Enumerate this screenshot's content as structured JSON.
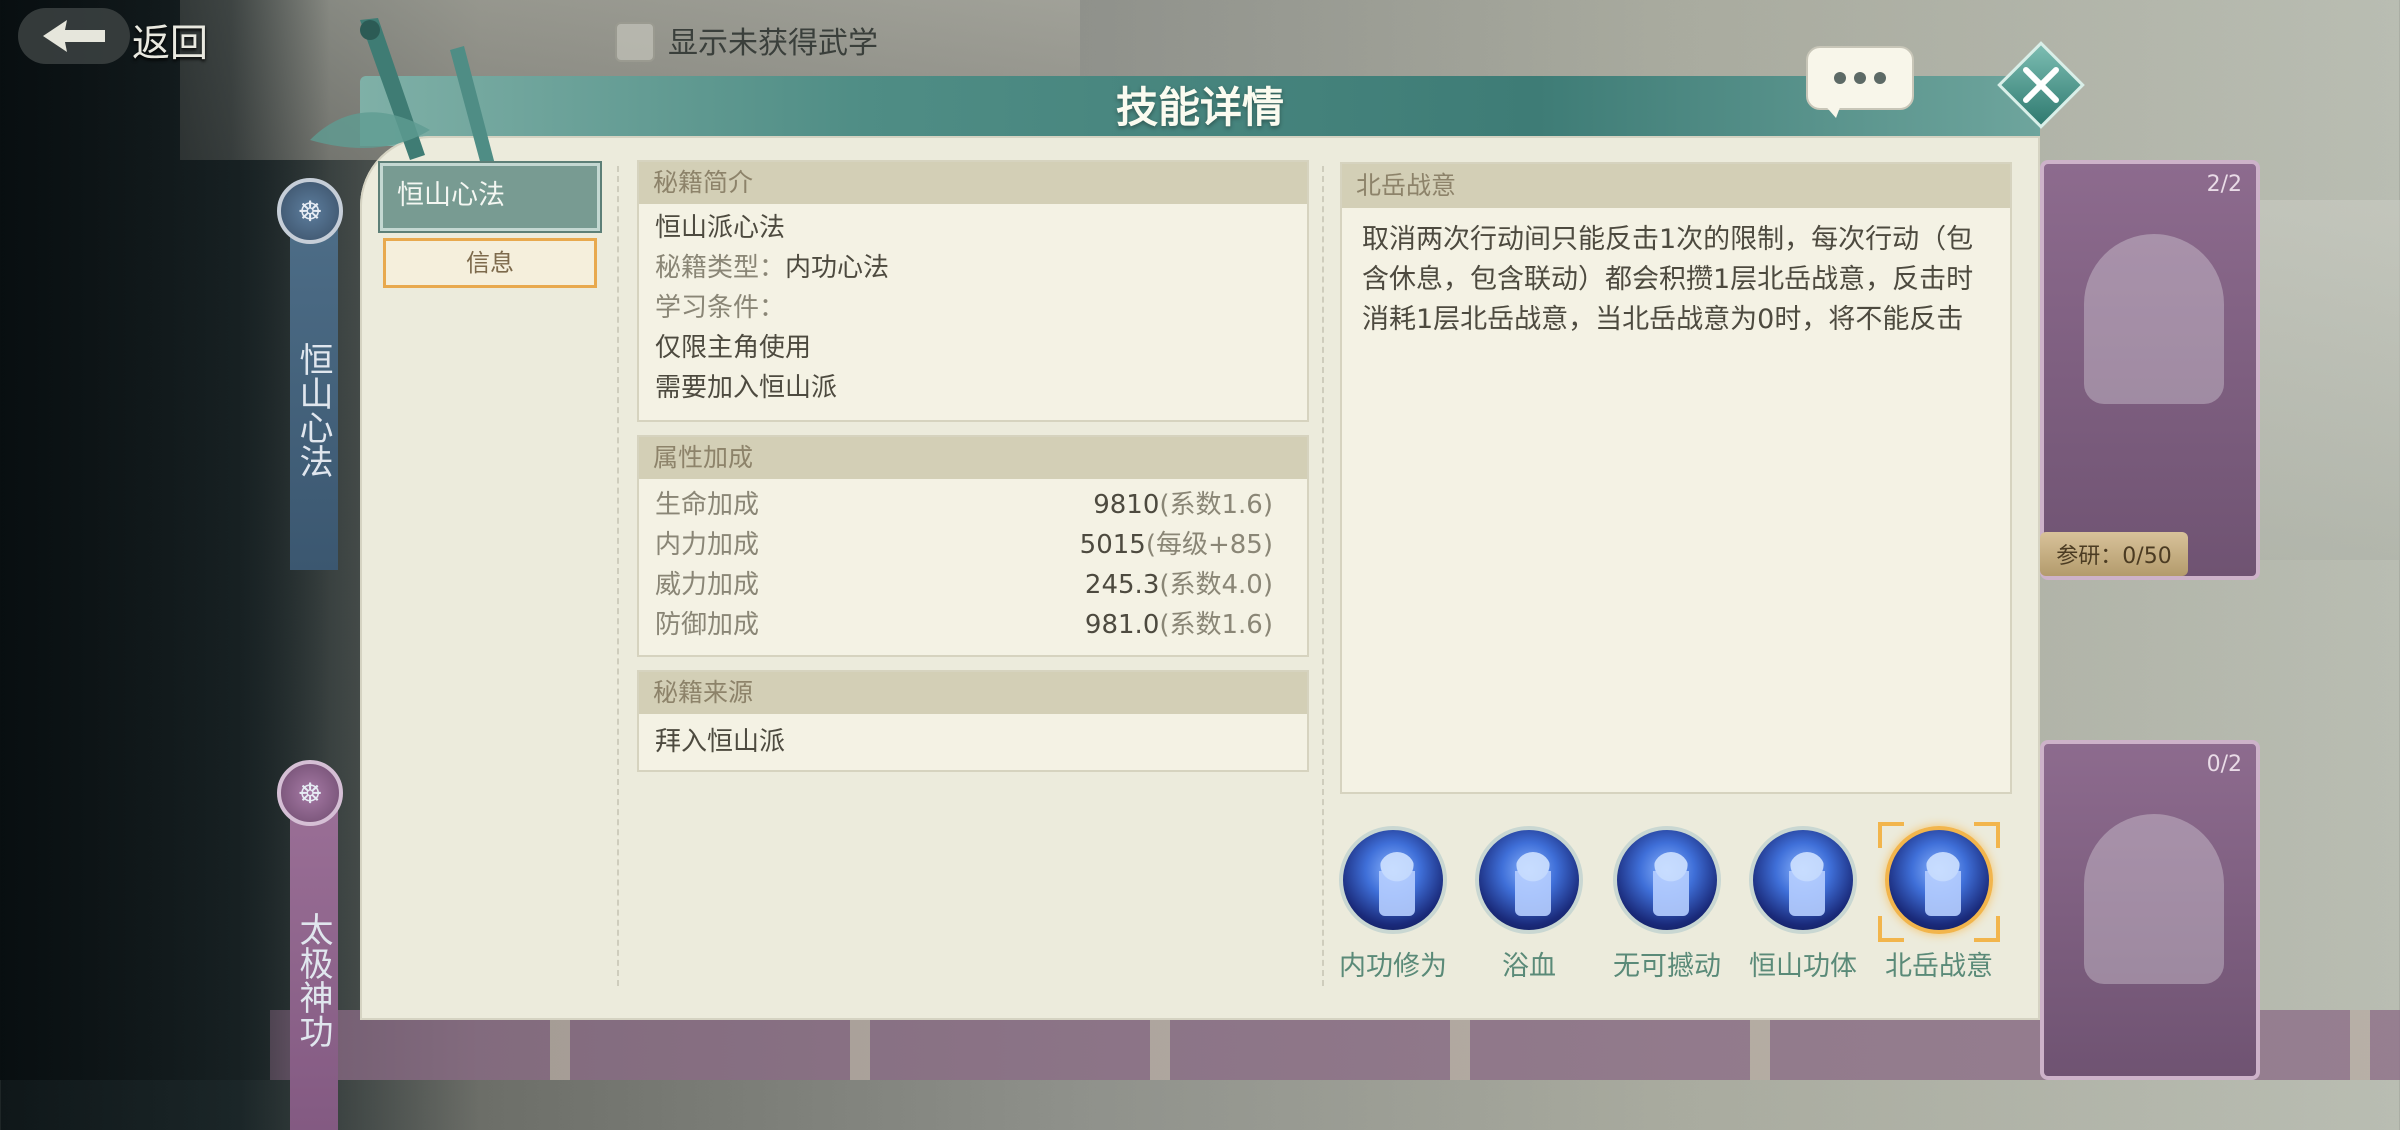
{
  "header": {
    "back_label": "返回",
    "show_unobtained_label": "显示未获得武学"
  },
  "side_scrolls": [
    {
      "label": "恒山心法"
    },
    {
      "label": "太极神功"
    }
  ],
  "cards": [
    {
      "count": "2/2",
      "research": "参研：0/50"
    },
    {
      "count": "0/2"
    }
  ],
  "dialog": {
    "title": "技能详情",
    "menu": {
      "active_item": "恒山心法",
      "sub_item": "信息"
    },
    "intro": {
      "heading": "秘籍简介",
      "name": "恒山派心法",
      "type": "秘籍类型：内功心法",
      "cond_label": "学习条件：",
      "cond_1": "仅限主角使用",
      "cond_2": "需要加入恒山派"
    },
    "attributes": {
      "heading": "属性加成",
      "rows": [
        {
          "key": "生命加成",
          "value": "9810",
          "coef": "(系数1.6)"
        },
        {
          "key": "内力加成",
          "value": "5015",
          "coef": "(每级+85)"
        },
        {
          "key": "威力加成",
          "value": "245.3",
          "coef": "(系数4.0)"
        },
        {
          "key": "防御加成",
          "value": "981.0",
          "coef": "(系数1.6)"
        }
      ]
    },
    "source": {
      "heading": "秘籍来源",
      "text": "拜入恒山派"
    },
    "skill_detail": {
      "heading": "北岳战意",
      "description": "取消两次行动间只能反击1次的限制，每次行动（包含休息，包含联动）都会积攒1层北岳战意，反击时消耗1层北岳战意，当北岳战意为0时，将不能反击"
    },
    "skills": [
      {
        "label": "内功修为",
        "selected": false
      },
      {
        "label": "浴血",
        "selected": false
      },
      {
        "label": "无可撼动",
        "selected": false
      },
      {
        "label": "恒山功体",
        "selected": false
      },
      {
        "label": "北岳战意",
        "selected": true
      }
    ]
  }
}
